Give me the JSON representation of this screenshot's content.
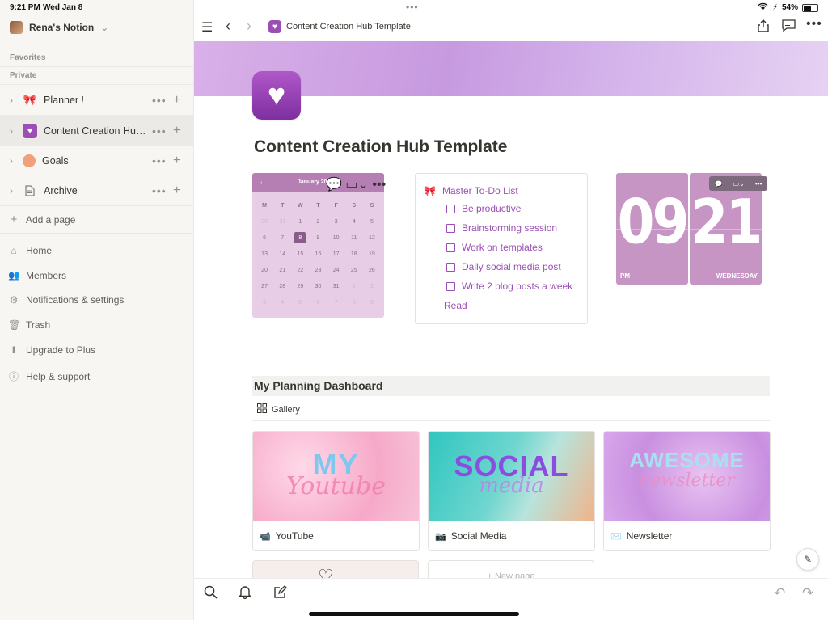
{
  "status": {
    "time": "9:21 PM",
    "date": "Wed Jan 8",
    "battery": "54%"
  },
  "sidebar": {
    "workspace": "Rena's Notion",
    "favorites_label": "Favorites",
    "private_label": "Private",
    "pages": [
      {
        "icon": "🎀",
        "title": "Planner !"
      },
      {
        "icon": "💜",
        "title": "Content Creation Hub Template"
      },
      {
        "icon": "🥯",
        "title": "Goals"
      },
      {
        "icon": "📄",
        "title": "Archive"
      }
    ],
    "add_page": "Add a page",
    "items": [
      {
        "icon": "home-icon",
        "label": "Home"
      },
      {
        "icon": "members-icon",
        "label": "Members"
      },
      {
        "icon": "settings-icon",
        "label": "Notifications & settings"
      },
      {
        "icon": "trash-icon",
        "label": "Trash"
      },
      {
        "icon": "upgrade-icon",
        "label": "Upgrade to Plus"
      },
      {
        "icon": "help-icon",
        "label": "Help & support"
      }
    ]
  },
  "topbar": {
    "breadcrumb": "Content Creation Hub Template"
  },
  "page": {
    "title": "Content Creation Hub Template"
  },
  "calendar": {
    "month": "January 20",
    "weekdays": [
      "M",
      "T",
      "W",
      "T",
      "F",
      "S",
      "S"
    ],
    "days": [
      "30",
      "31",
      "1",
      "2",
      "3",
      "4",
      "5",
      "6",
      "7",
      "8",
      "9",
      "10",
      "11",
      "12",
      "13",
      "14",
      "15",
      "16",
      "17",
      "18",
      "19",
      "20",
      "21",
      "22",
      "23",
      "24",
      "25",
      "26",
      "27",
      "28",
      "29",
      "30",
      "31",
      "1",
      "2",
      "3",
      "4",
      "5",
      "6",
      "7",
      "8",
      "9"
    ],
    "selected": "8"
  },
  "todo": {
    "title": "Master To-Do List",
    "items": [
      "Be productive",
      "Brainstorming session",
      "Work on templates",
      "Daily social media post",
      "Write 2 blog posts a week"
    ],
    "read": "Read"
  },
  "clock": {
    "hour": "09",
    "minute": "21",
    "ampm": "PM",
    "weekday": "WEDNESDAY"
  },
  "dashboard": {
    "title": "My Planning Dashboard",
    "view": "Gallery",
    "cards": [
      {
        "icon": "📹",
        "title": "YouTube",
        "art_big": "MY",
        "art_script": "Youtube"
      },
      {
        "icon": "📷",
        "title": "Social Media",
        "art_big": "SOCIAL",
        "art_script": "media"
      },
      {
        "icon": "✉️",
        "title": "Newsletter",
        "art_big": "AWESOME",
        "art_script": "newsletter"
      }
    ],
    "new_page": "+ New page"
  }
}
